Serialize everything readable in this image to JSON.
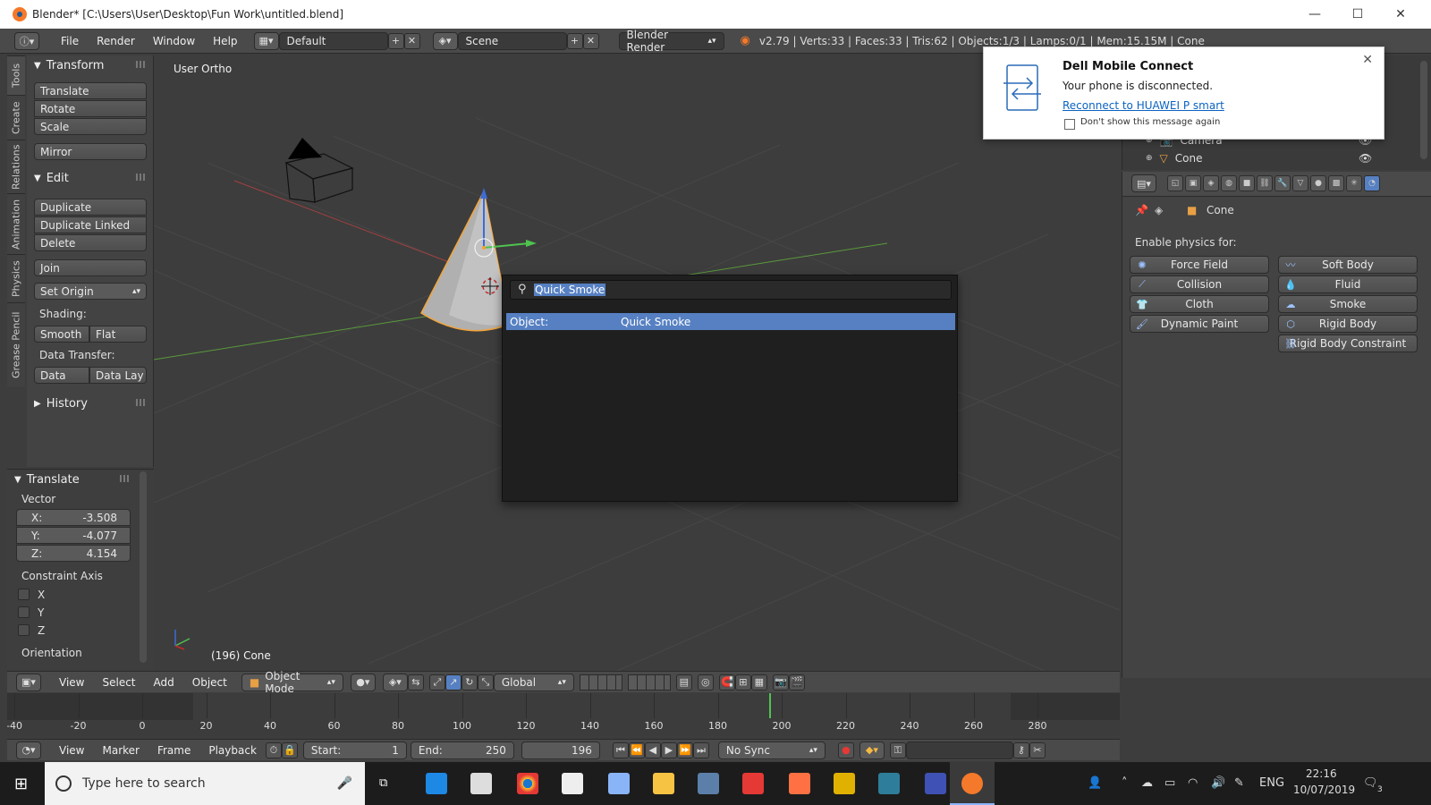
{
  "window": {
    "title": "Blender* [C:\\Users\\User\\Desktop\\Fun Work\\untitled.blend]",
    "minimize": "—",
    "maximize": "☐",
    "close": "✕"
  },
  "topbar": {
    "menus": [
      "File",
      "Render",
      "Window",
      "Help"
    ],
    "layout": "Default",
    "scene": "Scene",
    "engine": "Blender Render",
    "stats": "v2.79 | Verts:33 | Faces:33 | Tris:62 | Objects:1/3 | Lamps:0/1 | Mem:15.15M | Cone"
  },
  "tabs": [
    "Tools",
    "Create",
    "Relations",
    "Animation",
    "Physics",
    "Grease Pencil"
  ],
  "tools": {
    "transform_header": "Transform",
    "translate": "Translate",
    "rotate": "Rotate",
    "scale": "Scale",
    "mirror": "Mirror",
    "edit_header": "Edit",
    "duplicate": "Duplicate",
    "duplicate_linked": "Duplicate Linked",
    "delete": "Delete",
    "join": "Join",
    "set_origin": "Set Origin",
    "shading_label": "Shading:",
    "smooth": "Smooth",
    "flat": "Flat",
    "data_transfer_label": "Data Transfer:",
    "data": "Data",
    "data_lay": "Data Lay",
    "history_header": "History"
  },
  "redo": {
    "header": "Translate",
    "vector_label": "Vector",
    "x_label": "X:",
    "x_value": "-3.508",
    "y_label": "Y:",
    "y_value": "-4.077",
    "z_label": "Z:",
    "z_value": "4.154",
    "constraint_label": "Constraint Axis",
    "cx": "X",
    "cy": "Y",
    "cz": "Z",
    "orientation_label": "Orientation"
  },
  "viewport": {
    "view_label": "User Ortho",
    "object_info": "(196) Cone"
  },
  "search": {
    "query": "Quick Smoke",
    "result_category": "Object:",
    "result_name": "Quick Smoke"
  },
  "outliner": {
    "camera": "Camera",
    "cone": "Cone"
  },
  "properties": {
    "object_name": "Cone",
    "enable_label": "Enable physics for:",
    "force_field": "Force Field",
    "soft_body": "Soft Body",
    "collision": "Collision",
    "fluid": "Fluid",
    "cloth": "Cloth",
    "smoke": "Smoke",
    "dynamic_paint": "Dynamic Paint",
    "rigid_body": "Rigid Body",
    "rigid_body_constraint": "Rigid Body Constraint"
  },
  "notification": {
    "title": "Dell Mobile Connect",
    "message": "Your phone is disconnected.",
    "link": "Reconnect to HUAWEI P smart",
    "checkbox": "Don't show this message again"
  },
  "view3d_header": {
    "menus": [
      "View",
      "Select",
      "Add",
      "Object"
    ],
    "mode": "Object Mode",
    "orientation": "Global"
  },
  "timeline": {
    "ticks": [
      "-40",
      "-20",
      "0",
      "20",
      "40",
      "60",
      "80",
      "100",
      "120",
      "140",
      "160",
      "180",
      "200",
      "220",
      "240",
      "260",
      "280"
    ],
    "current_frame_value": 196
  },
  "timeline_header": {
    "menus": [
      "View",
      "Marker",
      "Frame",
      "Playback"
    ],
    "start_label": "Start:",
    "start_value": "1",
    "end_label": "End:",
    "end_value": "250",
    "frame": "196",
    "sync": "No Sync"
  },
  "taskbar": {
    "search_placeholder": "Type here to search",
    "lang": "ENG",
    "time": "22:16",
    "date": "10/07/2019",
    "notif_count": "3"
  },
  "colors": {
    "accent": "#5680c2",
    "blender_orange": "#f5792a"
  }
}
